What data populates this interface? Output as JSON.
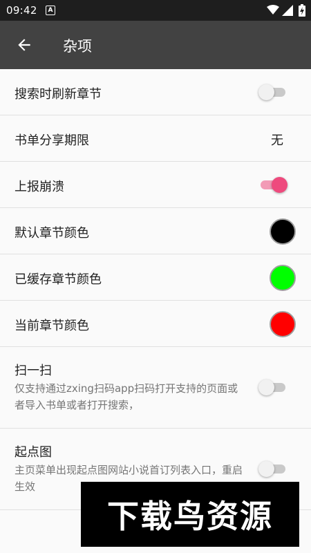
{
  "status_bar": {
    "time": "09:42",
    "notification_icon": "a-letter-icon",
    "icons": [
      "wifi-icon",
      "cell-signal-icon",
      "battery-charging-icon"
    ]
  },
  "toolbar": {
    "back_icon": "arrow-back-icon",
    "title": "杂项"
  },
  "settings": {
    "search_refresh": {
      "label": "搜索时刷新章节",
      "enabled": false
    },
    "booklist_share": {
      "label": "书单分享期限",
      "value": "无"
    },
    "crash_report": {
      "label": "上报崩溃",
      "enabled": true
    },
    "default_chapter_color": {
      "label": "默认章节颜色",
      "color": "#000000"
    },
    "cached_chapter_color": {
      "label": "已缓存章节颜色",
      "color": "#00ff00"
    },
    "current_chapter_color": {
      "label": "当前章节颜色",
      "color": "#ff0000"
    },
    "scan": {
      "label": "扫一扫",
      "summary": "仅支持通过zxing扫码app扫码打开支持的页面或者导入书单或者打开搜索，",
      "enabled": false
    },
    "qidian_map": {
      "label": "起点图",
      "summary": "主页菜单出现起点图网站小说首订列表入口，重启生效",
      "enabled": false
    }
  },
  "watermark": {
    "text": "下载鸟资源"
  },
  "colors": {
    "status_bar_bg": "#1e1e1e",
    "toolbar_bg": "#424242",
    "accent": "#ee4a7d",
    "background": "#fafafa"
  }
}
